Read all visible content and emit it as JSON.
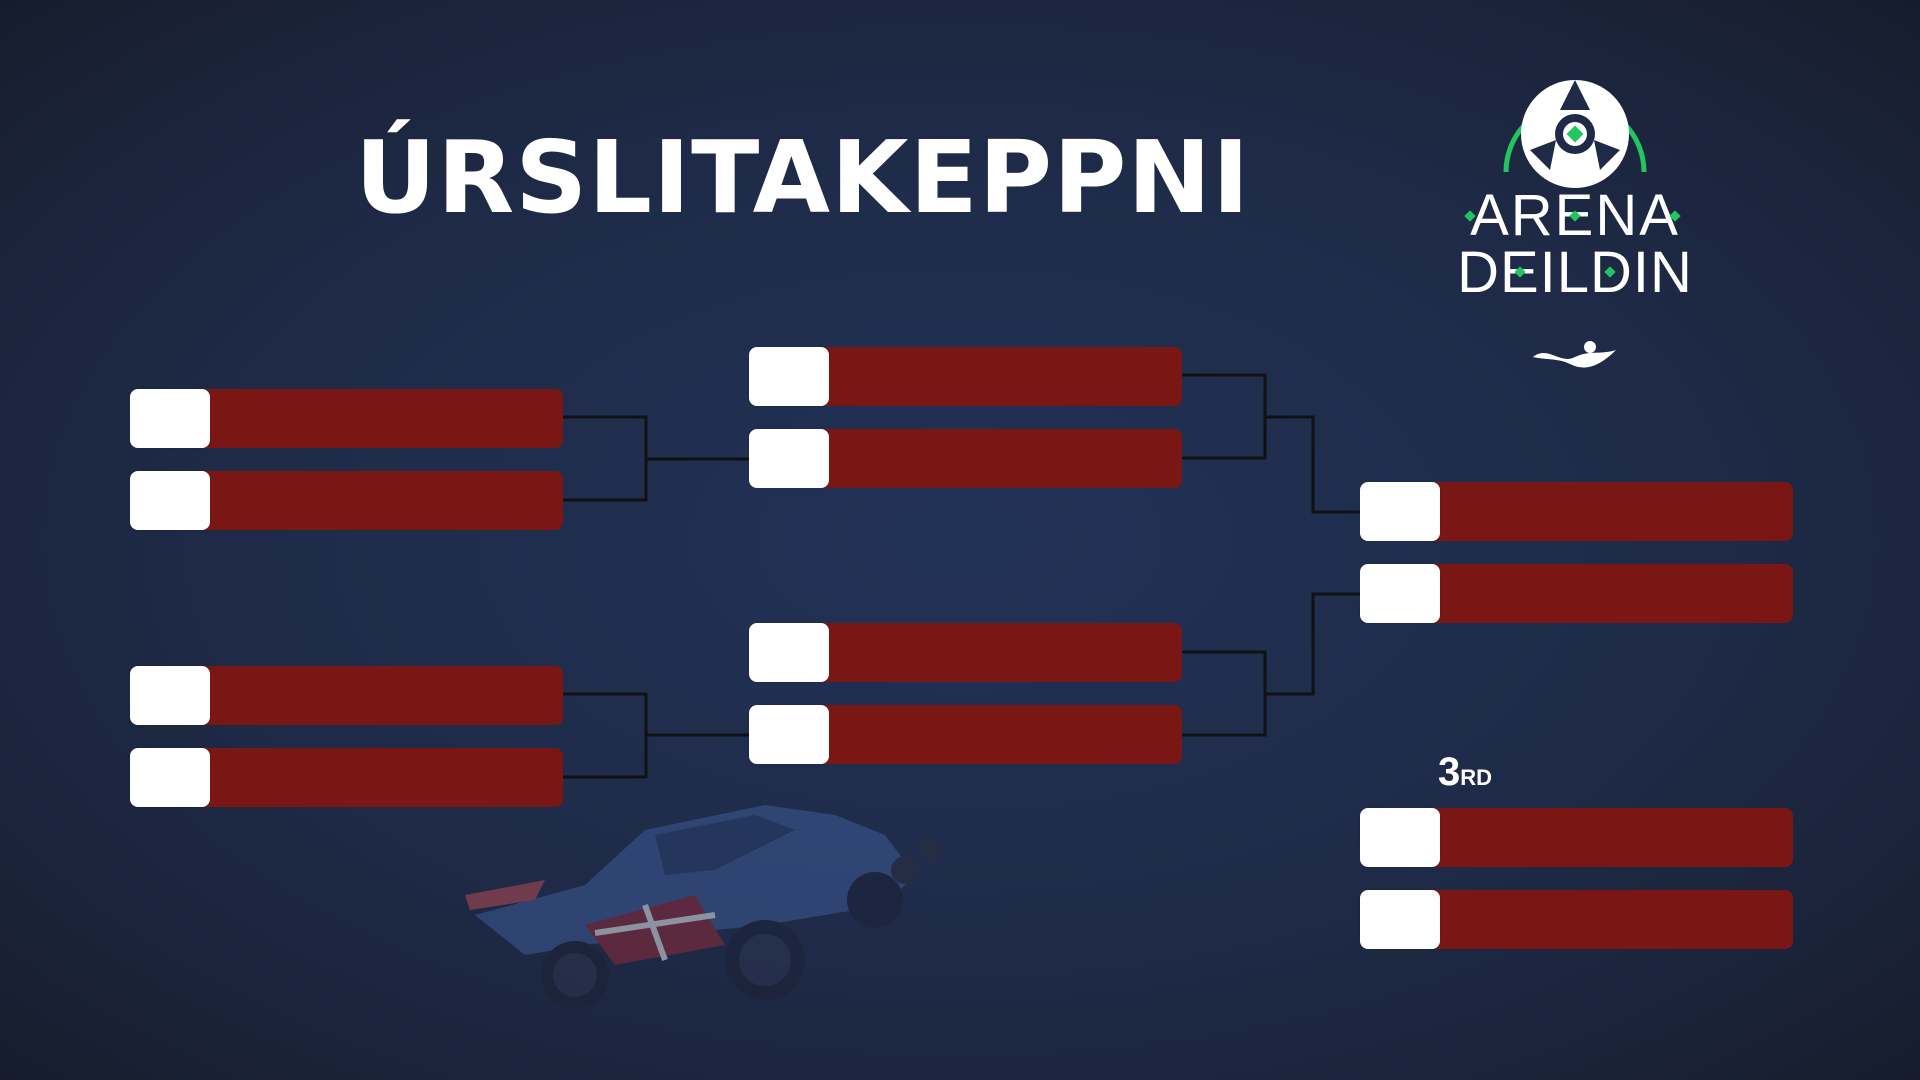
{
  "title": "ÚRSLITAKEPPNI",
  "logo": {
    "line1": "ARENA",
    "line2": "DEILDIN",
    "ring_color": "#22c55e",
    "icon": "rocket-league-ball-icon",
    "sub_icon": "swimmer-wave-icon"
  },
  "colors": {
    "background": "#1e2a47",
    "team_bar": "#7a1714",
    "score_box": "#ffffff",
    "connector": "#111111"
  },
  "third_place": {
    "number": "3",
    "suffix": "RD"
  },
  "bracket": {
    "quarterfinals": [
      {
        "team1": "",
        "score1": "",
        "team2": "",
        "score2": ""
      },
      {
        "team1": "",
        "score1": "",
        "team2": "",
        "score2": ""
      }
    ],
    "semifinals": [
      {
        "team1": "",
        "score1": "",
        "team2": "",
        "score2": ""
      },
      {
        "team1": "",
        "score1": "",
        "team2": "",
        "score2": ""
      }
    ],
    "final": {
      "team1": "",
      "score1": "",
      "team2": "",
      "score2": ""
    },
    "third_place_match": {
      "team1": "",
      "score1": "",
      "team2": "",
      "score2": ""
    }
  }
}
